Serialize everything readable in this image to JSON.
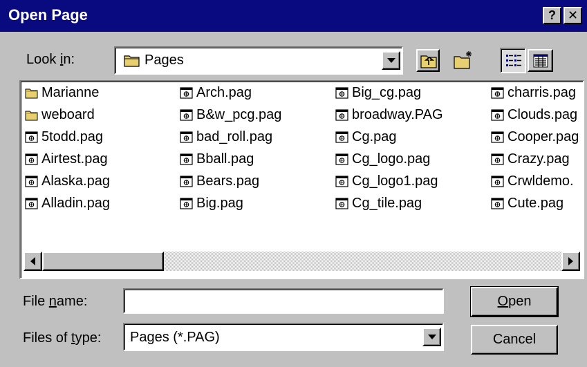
{
  "dialog": {
    "title": "Open Page",
    "help_button": "?",
    "close_button": "✕"
  },
  "look_in": {
    "label_pre": "Look ",
    "label_accel": "i",
    "label_post": "n:",
    "value": "Pages"
  },
  "files": [
    {
      "name": "Marianne",
      "type": "folder"
    },
    {
      "name": "weboard",
      "type": "folder"
    },
    {
      "name": "5todd.pag",
      "type": "file"
    },
    {
      "name": "Airtest.pag",
      "type": "file"
    },
    {
      "name": "Alaska.pag",
      "type": "file"
    },
    {
      "name": "Alladin.pag",
      "type": "file"
    },
    {
      "name": "Arch.pag",
      "type": "file"
    },
    {
      "name": "B&w_pcg.pag",
      "type": "file"
    },
    {
      "name": "bad_roll.pag",
      "type": "file"
    },
    {
      "name": "Bball.pag",
      "type": "file"
    },
    {
      "name": "Bears.pag",
      "type": "file"
    },
    {
      "name": "Big.pag",
      "type": "file"
    },
    {
      "name": "Big_cg.pag",
      "type": "file"
    },
    {
      "name": "broadway.PAG",
      "type": "file"
    },
    {
      "name": "Cg.pag",
      "type": "file"
    },
    {
      "name": "Cg_logo.pag",
      "type": "file"
    },
    {
      "name": "Cg_logo1.pag",
      "type": "file"
    },
    {
      "name": "Cg_tile.pag",
      "type": "file"
    },
    {
      "name": "charris.pag",
      "type": "file"
    },
    {
      "name": "Clouds.pag",
      "type": "file"
    },
    {
      "name": "Cooper.pag",
      "type": "file"
    },
    {
      "name": "Crazy.pag",
      "type": "file"
    },
    {
      "name": "Crwldemo.",
      "type": "file"
    },
    {
      "name": "Cute.pag",
      "type": "file"
    }
  ],
  "file_name": {
    "label_pre": "File ",
    "label_accel": "n",
    "label_post": "ame:",
    "value": ""
  },
  "files_of_type": {
    "label_pre": "Files of ",
    "label_accel": "t",
    "label_post": "ype:",
    "value": "Pages (*.PAG)"
  },
  "buttons": {
    "open_accel": "O",
    "open_rest": "pen",
    "cancel": "Cancel"
  },
  "icons": {
    "folder": "folder-icon",
    "file": "page-file-icon",
    "up_folder": "up-one-level-icon",
    "new_folder": "create-new-folder-icon",
    "list_view": "list-view-icon",
    "details_view": "details-view-icon"
  }
}
